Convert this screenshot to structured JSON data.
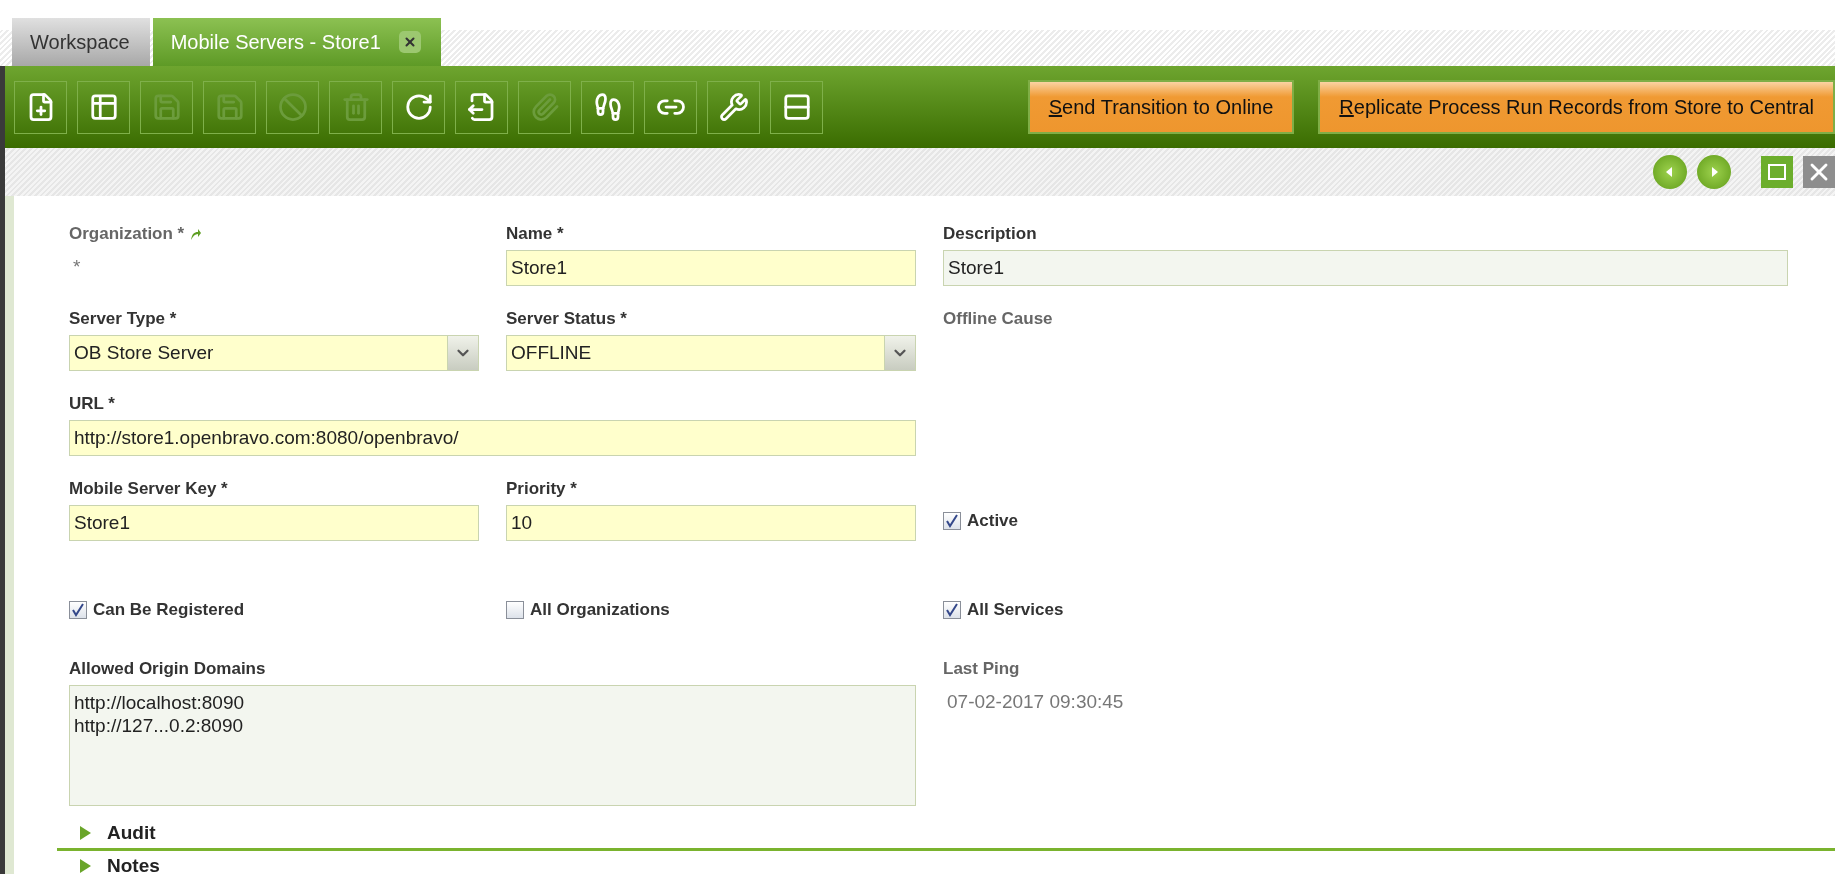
{
  "tabs": [
    {
      "label": "Workspace",
      "selected": false,
      "closable": false
    },
    {
      "label": "Mobile Servers - Store1",
      "selected": true,
      "closable": true
    }
  ],
  "toolbar": {
    "buttons": [
      {
        "kind": "new",
        "disabled": false
      },
      {
        "kind": "grid",
        "disabled": false
      },
      {
        "kind": "save",
        "disabled": true
      },
      {
        "kind": "save-close",
        "disabled": true
      },
      {
        "kind": "cancel",
        "disabled": true
      },
      {
        "kind": "delete",
        "disabled": true
      },
      {
        "kind": "refresh",
        "disabled": false
      },
      {
        "kind": "export",
        "disabled": false
      },
      {
        "kind": "attach",
        "disabled": true
      },
      {
        "kind": "audit",
        "disabled": false
      },
      {
        "kind": "link",
        "disabled": false
      },
      {
        "kind": "tools",
        "disabled": false
      },
      {
        "kind": "layout",
        "disabled": false
      }
    ],
    "process_buttons": [
      {
        "accesskey": "S",
        "label": "end Transition to Online"
      },
      {
        "accesskey": "R",
        "label": "eplicate Process Run Records from Store to Central"
      }
    ]
  },
  "form": {
    "rows": [
      [
        {
          "kind": "readonly",
          "label": "Organization *",
          "link": true,
          "value": "*"
        },
        {
          "kind": "text",
          "label": "Name *",
          "required": true,
          "value": "Store1"
        },
        {
          "kind": "text",
          "label": "Description",
          "required": false,
          "value": "Store1"
        }
      ],
      [
        {
          "kind": "select",
          "label": "Server Type *",
          "required": true,
          "value": "OB Store Server"
        },
        {
          "kind": "select",
          "label": "Server Status *",
          "required": true,
          "value": "OFFLINE"
        },
        {
          "kind": "readonly",
          "label": "Offline Cause"
        }
      ],
      [
        {
          "kind": "text",
          "label": "URL *",
          "required": true,
          "value": "http://store1.openbravo.com:8080/openbravo/",
          "span": true
        }
      ],
      [
        {
          "kind": "text",
          "label": "Mobile Server Key *",
          "required": true,
          "value": "Store1"
        },
        {
          "kind": "text",
          "label": "Priority *",
          "required": true,
          "value": "10"
        },
        {
          "kind": "checkbox",
          "label": "Active",
          "checked": true
        }
      ],
      [
        {
          "kind": "checkbox",
          "label": "Can Be Registered",
          "checked": true
        },
        {
          "kind": "checkbox",
          "label": "All Organizations",
          "checked": false
        },
        {
          "kind": "checkbox",
          "label": "All Services",
          "checked": true
        }
      ],
      [
        {
          "kind": "textarea",
          "label": "Allowed Origin Domains",
          "required": false,
          "lines": [
            "http://localhost:8090",
            "http://127...0.2:8090"
          ],
          "span": true
        },
        "",
        {
          "kind": "readonly",
          "label": "Last Ping",
          "value": "07-02-2017 09:30:45"
        }
      ]
    ]
  },
  "sections": [
    {
      "label": "Audit",
      "expanded": false
    },
    {
      "label": "Notes",
      "expanded": false
    }
  ]
}
